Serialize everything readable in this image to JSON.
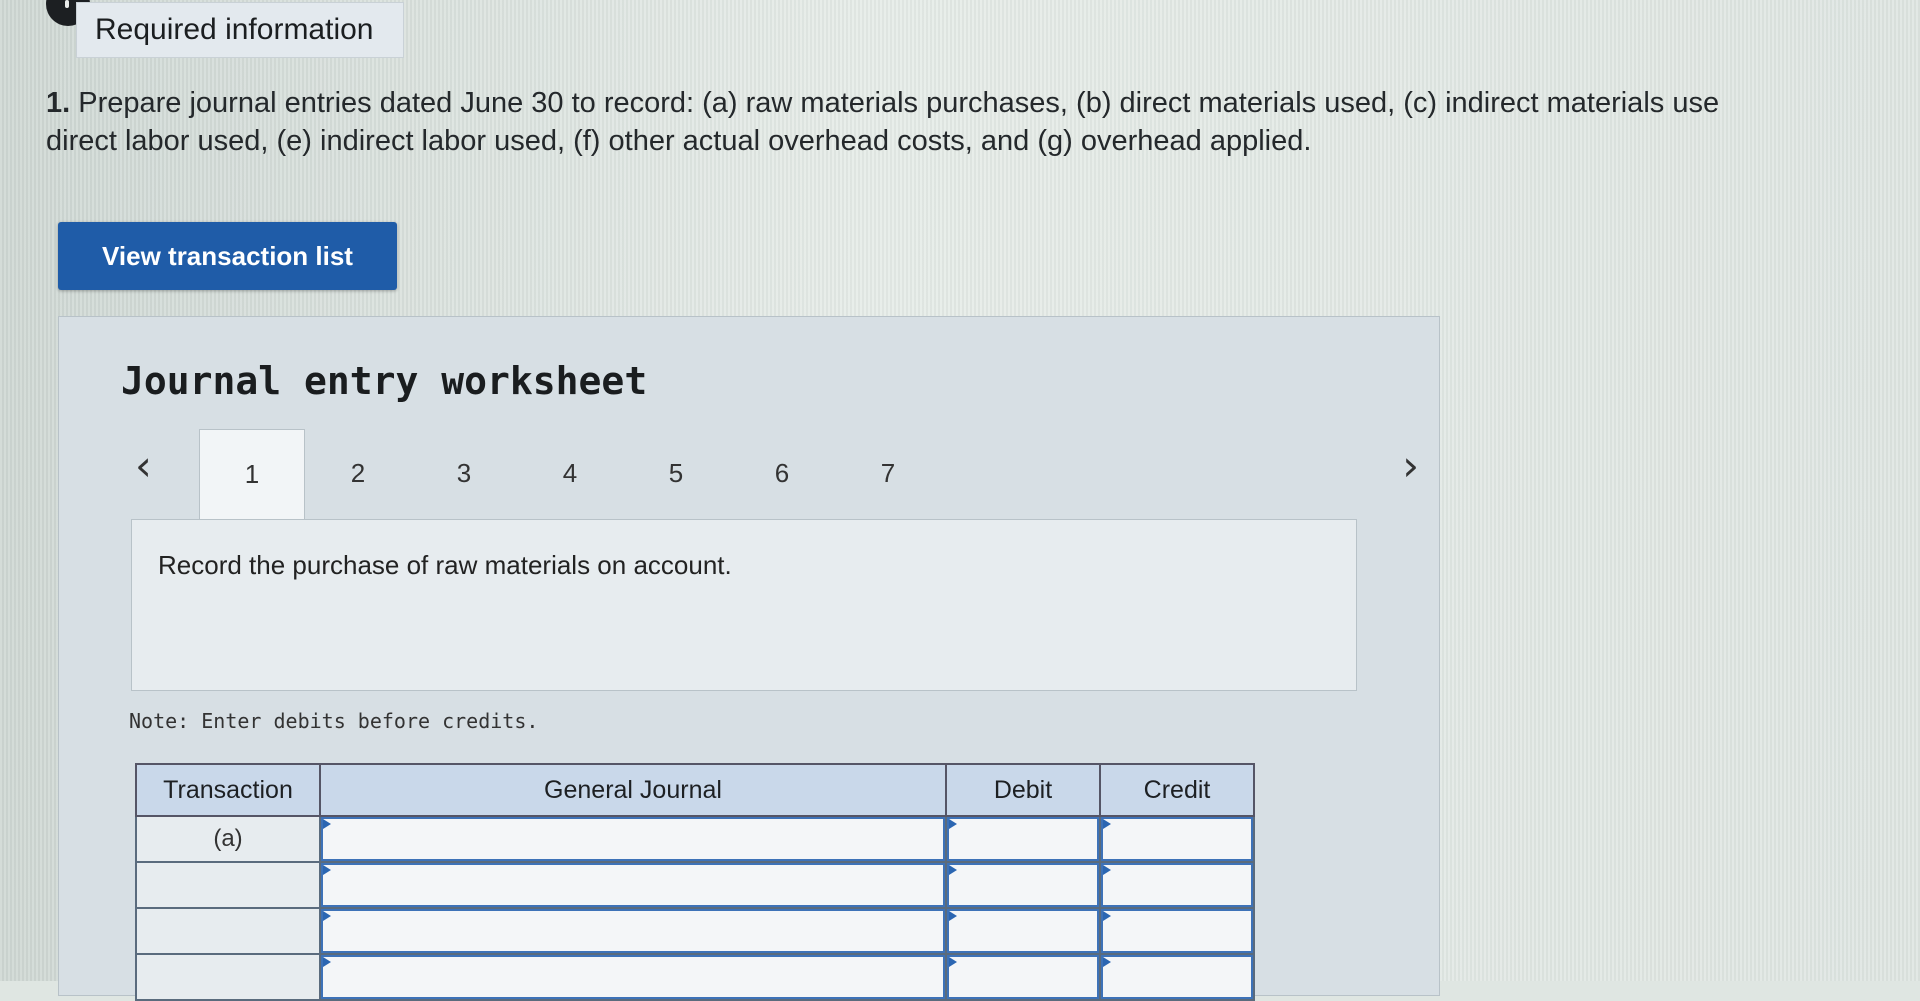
{
  "header": {
    "tab_label": "Required information"
  },
  "question": {
    "number": "1.",
    "line1": "Prepare journal entries dated June 30 to record: (a) raw materials purchases, (b) direct materials used, (c) indirect materials use",
    "line2": "direct labor used, (e) indirect labor used, (f) other actual overhead costs, and (g) overhead applied."
  },
  "actions": {
    "view_transactions": "View transaction list"
  },
  "worksheet": {
    "title": "Journal entry worksheet",
    "pages": [
      "1",
      "2",
      "3",
      "4",
      "5",
      "6",
      "7"
    ],
    "active_page": "1",
    "prev_icon": "chevron-left-icon",
    "next_icon": "chevron-right-icon",
    "prompt": "Record the purchase of raw materials on account.",
    "note": "Note: Enter debits before credits.",
    "table": {
      "headers": [
        "Transaction",
        "General Journal",
        "Debit",
        "Credit"
      ],
      "rows": [
        {
          "transaction": "(a)"
        },
        {
          "transaction": ""
        },
        {
          "transaction": ""
        },
        {
          "transaction": ""
        }
      ]
    }
  },
  "colors": {
    "button": "#1f5ca8",
    "header_cell": "#c9d8ea",
    "background": "#dfe6e2"
  }
}
